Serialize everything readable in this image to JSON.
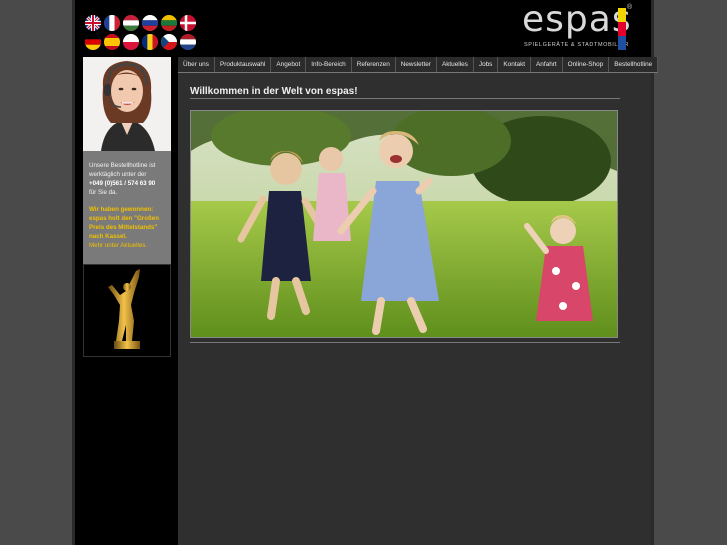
{
  "header": {
    "logo_word": "espas",
    "logo_tagline": "SPIELGERÄTE & STADTMOBILIAR",
    "logo_registered": "®",
    "flags": [
      {
        "name": "uk-flag",
        "code": "en"
      },
      {
        "name": "france-flag",
        "code": "fr"
      },
      {
        "name": "hungary-flag",
        "code": "hu"
      },
      {
        "name": "russia-flag",
        "code": "ru"
      },
      {
        "name": "lithuania-flag",
        "code": "lt"
      },
      {
        "name": "denmark-flag",
        "code": "da"
      },
      {
        "name": "germany-flag",
        "code": "de"
      },
      {
        "name": "spain-flag",
        "code": "es"
      },
      {
        "name": "poland-flag",
        "code": "pl"
      },
      {
        "name": "romania-flag",
        "code": "ro"
      },
      {
        "name": "czech-flag",
        "code": "cs"
      },
      {
        "name": "netherlands-flag",
        "code": "nl"
      }
    ]
  },
  "nav": {
    "items": [
      "Über uns",
      "Produktauswahl",
      "Angebot",
      "Info-Bereich",
      "Referenzen",
      "Newsletter",
      "Aktuelles",
      "Jobs",
      "Kontakt",
      "Anfahrt",
      "Online-Shop",
      "Bestellhotline"
    ]
  },
  "sidebar": {
    "hotline_text_1": "Unsere Bestellhotline ist werktäglich unter der",
    "hotline_phone": "+049 (0)561 / 574 63 90",
    "hotline_text_2": "für Sie da.",
    "award_text": "Wir haben gewonnen: espas holt den \"Großen Preis des Mittelstands\" nach Kassel.",
    "more_link": "Mehr unter Aktuelles."
  },
  "main": {
    "heading": "Willkommen in der Welt von espas!"
  },
  "colors": {
    "page_bg": "#4a4a4a",
    "accent_gold": "#f0c000",
    "logo_yellow": "#f2d600",
    "logo_red": "#e4002b",
    "logo_blue": "#1f4fa0"
  }
}
